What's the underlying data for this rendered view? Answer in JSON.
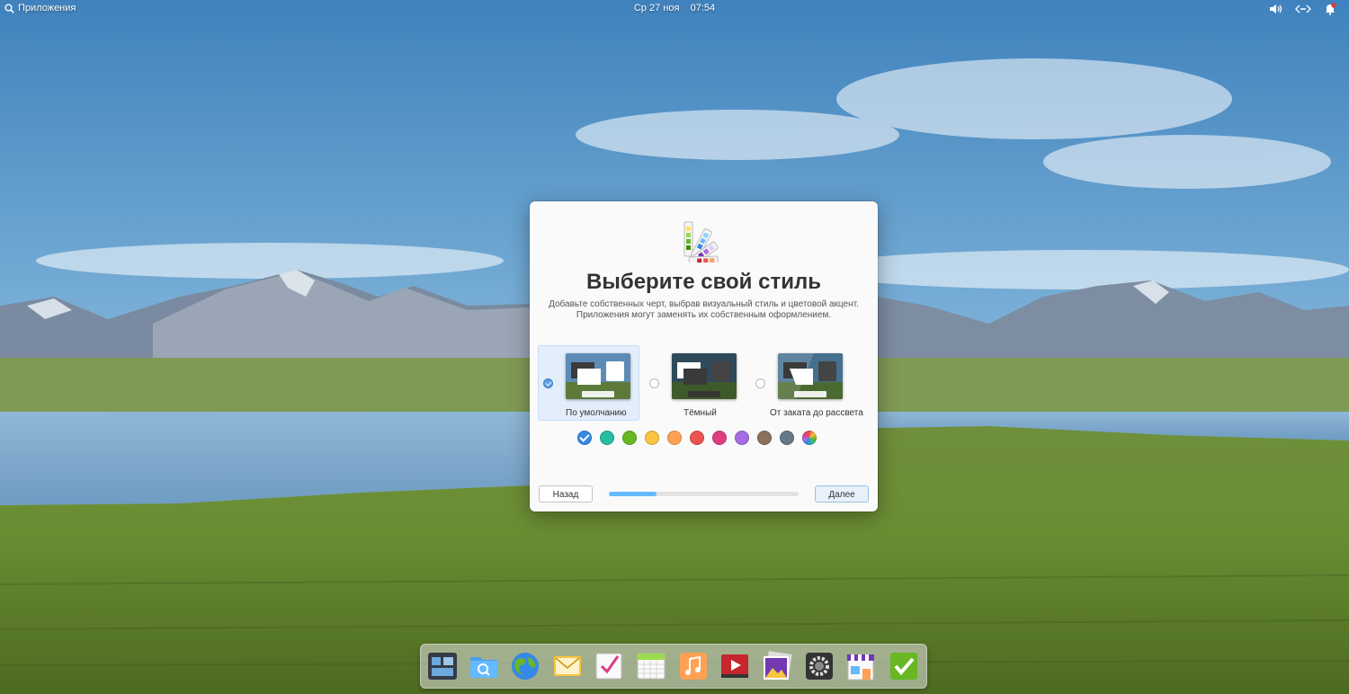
{
  "top_panel": {
    "applications_label": "Приложения",
    "datetime": "Ср 27 ноя    07:54",
    "indicators": [
      "volume-icon",
      "network-icon",
      "notifications-icon"
    ]
  },
  "dialog": {
    "title": "Выберите свой стиль",
    "subtitle": "Добавьте собственных черт, выбрав визуальный стиль и цветовой акцент. Приложения могут заменять их собственным оформлением.",
    "styles": [
      {
        "label": "По умолчанию",
        "selected": true
      },
      {
        "label": "Тёмный",
        "selected": false
      },
      {
        "label": "От заката до рассвета",
        "selected": false
      }
    ],
    "accent_colors": [
      "#3689e6",
      "#28bca3",
      "#68b723",
      "#f9c440",
      "#ffa154",
      "#ed5353",
      "#de3e80",
      "#a56de2",
      "#8a715e",
      "#667885",
      "multicolor"
    ],
    "selected_accent": "#3689e6",
    "back_label": "Назад",
    "next_label": "Далее",
    "progress": 0.25
  },
  "dock": {
    "apps": [
      "multitasking-view-icon",
      "files-icon",
      "web-browser-icon",
      "mail-icon",
      "tasks-icon",
      "calendar-icon",
      "music-icon",
      "videos-icon",
      "photos-icon",
      "system-settings-icon",
      "appcenter-icon",
      "onboarding-icon"
    ]
  }
}
